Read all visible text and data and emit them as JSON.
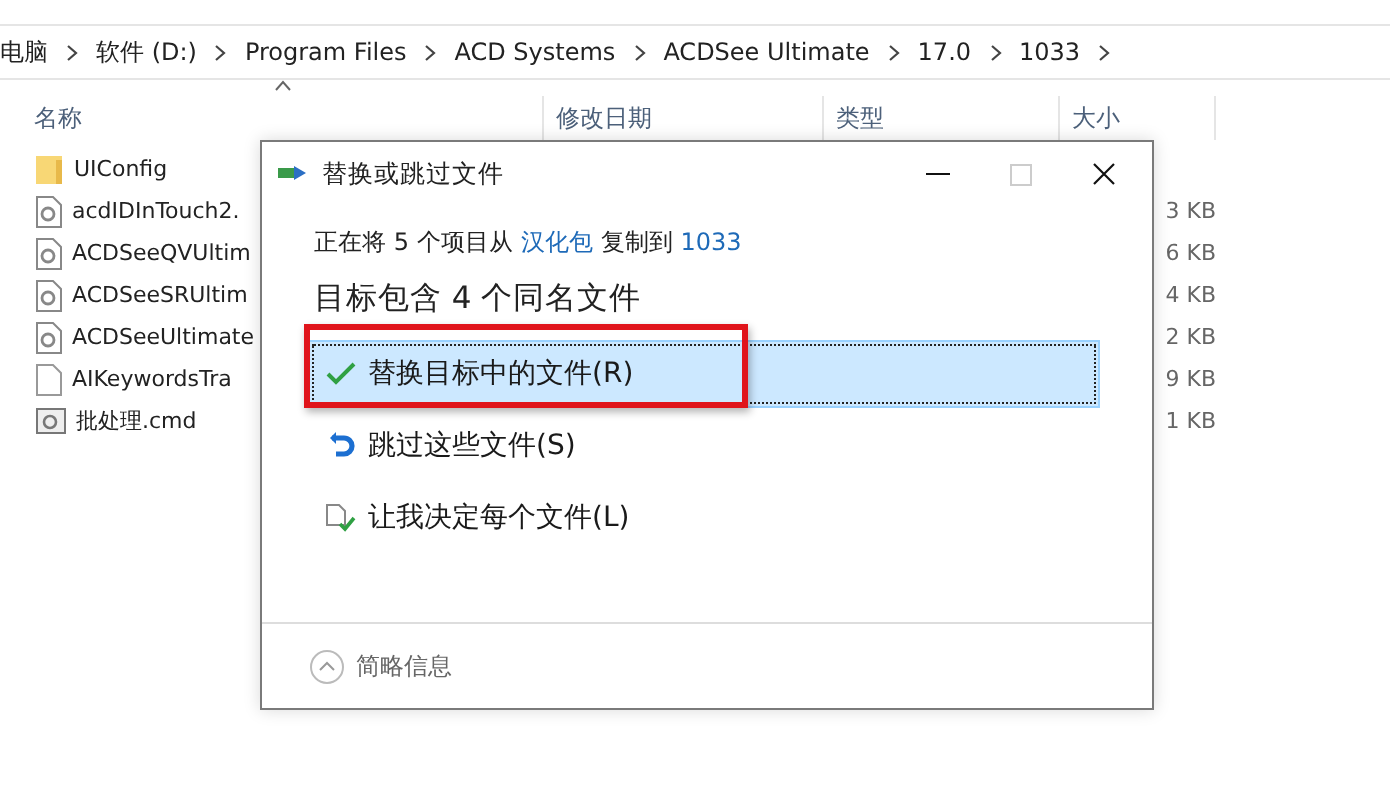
{
  "breadcrumb": [
    "电脑",
    "软件 (D:)",
    "Program Files",
    "ACD Systems",
    "ACDSee Ultimate",
    "17.0",
    "1033"
  ],
  "columns": [
    "名称",
    "修改日期",
    "类型",
    "大小"
  ],
  "files": [
    {
      "name": "UIConfig",
      "kind": "folder"
    },
    {
      "name": "acdIDInTouch2.",
      "kind": "dll",
      "size": "3 KB"
    },
    {
      "name": "ACDSeeQVUltim",
      "kind": "dll",
      "size": "6 KB"
    },
    {
      "name": "ACDSeeSRUltim",
      "kind": "dll",
      "size": "4 KB"
    },
    {
      "name": "ACDSeeUltimate",
      "kind": "dll",
      "size": "2 KB"
    },
    {
      "name": "AIKeywordsTra",
      "kind": "blank",
      "size": "9 KB"
    },
    {
      "name": "批处理.cmd",
      "kind": "cmd",
      "size": "1 KB"
    }
  ],
  "dialog": {
    "title": "替换或跳过文件",
    "message": {
      "prefix": "正在将 5 个项目从",
      "source": "汉化包",
      "middle": "复制到",
      "destination": "1033"
    },
    "heading": "目标包含 4 个同名文件",
    "options": [
      {
        "label": "替换目标中的文件(R)",
        "kind": "replace",
        "selected": true,
        "highlight_box": true
      },
      {
        "label": "跳过这些文件(S)",
        "kind": "skip",
        "selected": false,
        "highlight_box": false
      },
      {
        "label": "让我决定每个文件(L)",
        "kind": "decide",
        "selected": false,
        "highlight_box": false
      }
    ],
    "footer": "简略信息"
  }
}
